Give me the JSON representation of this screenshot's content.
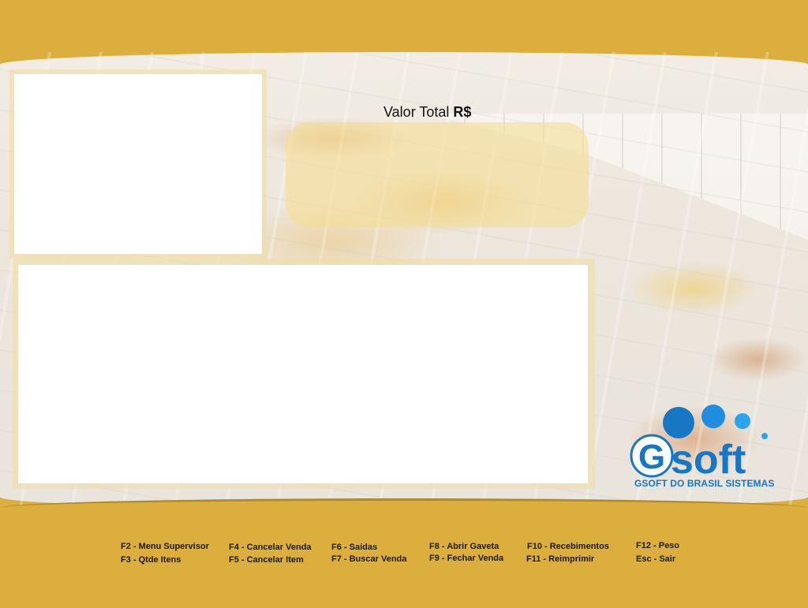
{
  "total": {
    "label": "Valor Total",
    "currency": "R$",
    "value": ""
  },
  "logo": {
    "mark": "Gsoft",
    "subtitle": "GSOFT DO BRASIL SISTEMAS",
    "color": "#1877c4"
  },
  "function_keys": [
    {
      "id": "f2",
      "label": "F2 - Menu Supervisor"
    },
    {
      "id": "f3",
      "label": "F3 - Qtde Itens"
    },
    {
      "id": "f4",
      "label": "F4 - Cancelar Venda"
    },
    {
      "id": "f5",
      "label": "F5 - Cancelar Item"
    },
    {
      "id": "f6",
      "label": "F6 - Saídas"
    },
    {
      "id": "f7",
      "label": "F7 - Buscar Venda"
    },
    {
      "id": "f8",
      "label": "F8 - Abrir Gaveta"
    },
    {
      "id": "f9",
      "label": "F9 - Fechar Venda"
    },
    {
      "id": "f10",
      "label": "F10 - Recebimentos"
    },
    {
      "id": "f11",
      "label": "F11 - Reimprimir"
    },
    {
      "id": "f12",
      "label": "F12 - Peso"
    },
    {
      "id": "esc",
      "label": "Esc - Sair"
    }
  ],
  "colors": {
    "band": "#dcae3e",
    "brand": "#1877c4"
  }
}
